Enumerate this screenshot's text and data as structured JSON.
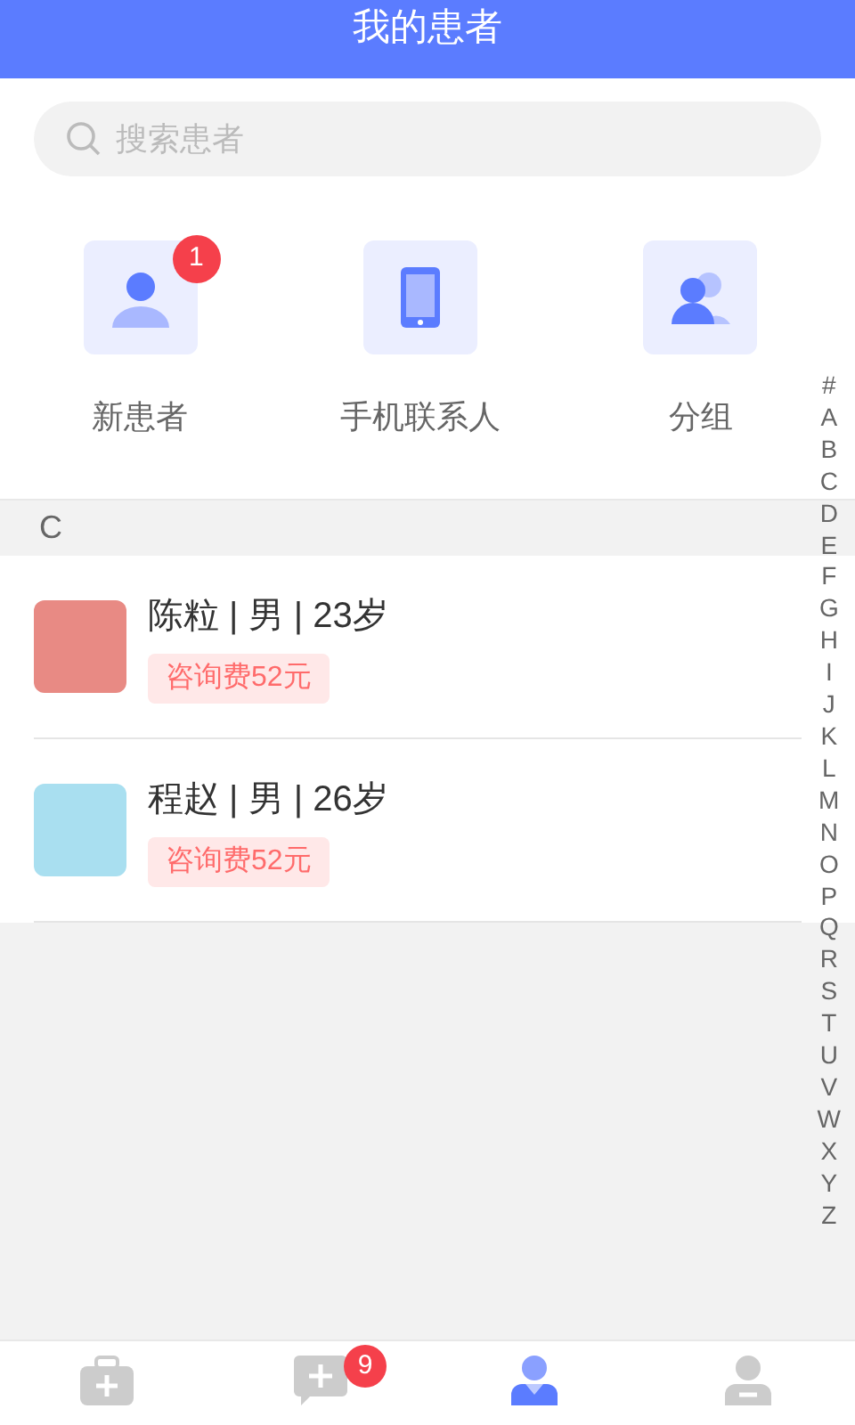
{
  "header": {
    "title": "我的患者"
  },
  "search": {
    "placeholder": "搜索患者"
  },
  "shortcuts": [
    {
      "kind": "person",
      "label": "新患者",
      "badge": "1"
    },
    {
      "kind": "phone",
      "label": "手机联系人"
    },
    {
      "kind": "group",
      "label": "分组"
    }
  ],
  "sections": [
    {
      "letter": "C",
      "patients": [
        {
          "name": "陈粒 | 男 | 23岁",
          "fee": "咨询费52元",
          "color": "#e88a84"
        },
        {
          "name": "程赵 | 男 | 26岁",
          "fee": "咨询费52元",
          "color": "#a9dff0"
        }
      ]
    }
  ],
  "index_letters": [
    "#",
    "A",
    "B",
    "C",
    "D",
    "E",
    "F",
    "G",
    "H",
    "I",
    "J",
    "K",
    "L",
    "M",
    "N",
    "O",
    "P",
    "Q",
    "R",
    "S",
    "T",
    "U",
    "V",
    "W",
    "X",
    "Y",
    "Z"
  ],
  "tab_bar": [
    {
      "kind": "kit",
      "selected": false
    },
    {
      "kind": "chat",
      "selected": false,
      "badge": "9"
    },
    {
      "kind": "patient",
      "selected": true
    },
    {
      "kind": "me",
      "selected": false
    }
  ]
}
